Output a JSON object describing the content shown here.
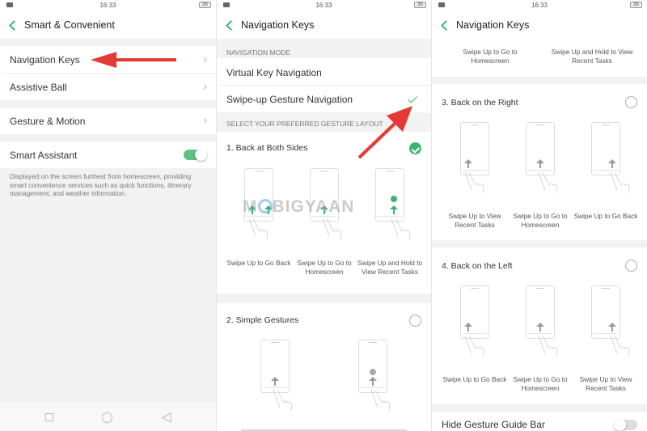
{
  "status_bar": {
    "time": "16:33",
    "battery": "35"
  },
  "panel1": {
    "title": "Smart & Convenient",
    "items": [
      {
        "label": "Navigation Keys"
      },
      {
        "label": "Assistive Ball"
      },
      {
        "label": "Gesture & Motion"
      }
    ],
    "smart_assistant": {
      "label": "Smart Assistant",
      "enabled": true,
      "description": "Displayed on the screen furthest from homescreen, providing smart convenience services such as quick functions, itinerary management, and weather information."
    }
  },
  "panel2": {
    "title": "Navigation Keys",
    "nav_mode_header": "NAVIGATION MODE",
    "nav_modes": [
      {
        "label": "Virtual Key Navigation",
        "selected": false
      },
      {
        "label": "Swipe-up Gesture Navigation",
        "selected": true
      }
    ],
    "layout_header": "SELECT YOUR PREFERRED GESTURE LAYOUT",
    "layouts": [
      {
        "label": "1. Back at Both Sides",
        "selected": true,
        "captions": [
          "Swipe Up to Go Back",
          "Swipe Up to Go to Homescreen",
          "Swipe Up and Hold to View Recent Tasks"
        ]
      },
      {
        "label": "2. Simple Gestures",
        "selected": false
      }
    ]
  },
  "panel3": {
    "title": "Navigation Keys",
    "top_captions": [
      "Swipe Up to Go to Homescreen",
      "Swipe Up and Hold to View Recent Tasks"
    ],
    "layouts": [
      {
        "label": "3. Back on the Right",
        "selected": false,
        "captions": [
          "Swipe Up to View Recent Tasks",
          "Swipe Up to Go to Homescreen",
          "Swipe Up to Go Back"
        ]
      },
      {
        "label": "4. Back on the Left",
        "selected": false,
        "captions": [
          "Swipe Up to Go Back",
          "Swipe Up to Go to Homescreen",
          "Swipe Up to View Recent Tasks"
        ]
      }
    ],
    "hide_bar": {
      "label": "Hide Gesture Guide Bar",
      "enabled": false
    }
  },
  "watermark": {
    "text_pre": "M",
    "text_post": "BIGYAAN"
  },
  "colors": {
    "accent": "#3cb371",
    "annotation": "#e53935"
  }
}
